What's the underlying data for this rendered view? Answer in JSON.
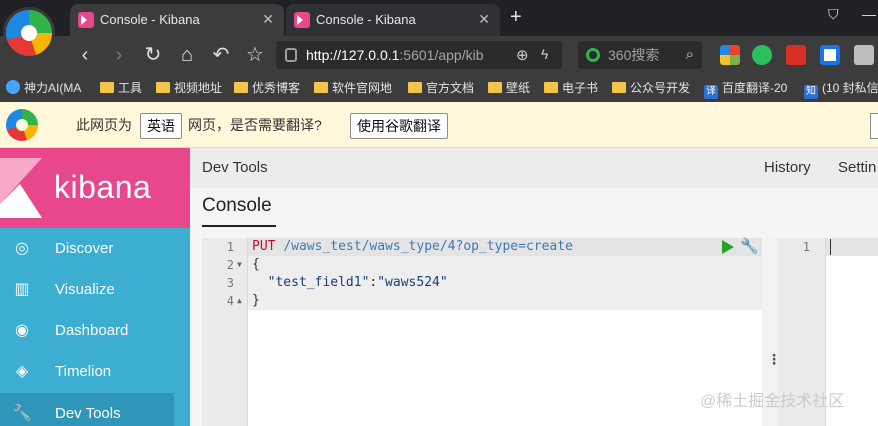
{
  "browser": {
    "tabs": [
      {
        "title": "Console - Kibana",
        "close": "✕"
      },
      {
        "title": "Console - Kibana",
        "close": "✕"
      }
    ],
    "new_tab": "+",
    "window_controls": {
      "shirt": "⛉",
      "minimize": "—"
    },
    "nav": {
      "back": "‹",
      "forward": "›",
      "reload": "↻",
      "home": "⌂",
      "undo": "↶",
      "star": "☆"
    },
    "address": {
      "host": "http://127.0.0.1",
      "rest": ":5601/app/kib",
      "zoom": "⊕",
      "bolt": "ϟ"
    },
    "search": {
      "placeholder": "360搜索",
      "icon": "⌕"
    },
    "extensions": [
      {
        "name": "windows-icon",
        "color": "#e8452c"
      },
      {
        "name": "evernote-icon",
        "color": "#2dbe60"
      },
      {
        "name": "fe-icon",
        "color": "#d93025"
      },
      {
        "name": "layers-icon",
        "color": "#1a73e8"
      },
      {
        "name": "bookmark-ext-icon",
        "color": "#9e9e9e"
      }
    ]
  },
  "bookmarks": [
    {
      "label": "神力AI(MA",
      "icon": "round"
    },
    {
      "label": "工具",
      "icon": "folder"
    },
    {
      "label": "视频地址",
      "icon": "folder"
    },
    {
      "label": "优秀博客",
      "icon": "folder"
    },
    {
      "label": "软件官网地",
      "icon": "folder"
    },
    {
      "label": "官方文档",
      "icon": "folder"
    },
    {
      "label": "壁纸",
      "icon": "folder"
    },
    {
      "label": "电子书",
      "icon": "folder"
    },
    {
      "label": "公众号开发",
      "icon": "folder"
    },
    {
      "label": "百度翻译-20",
      "icon": "badge",
      "badge": "译"
    },
    {
      "label": "(10 封私信",
      "icon": "badge",
      "badge": "知"
    }
  ],
  "translate_bar": {
    "prefix": "此网页为",
    "language": "英语",
    "middle": "网页，是否需要翻译?",
    "action": "使用谷歌翻译"
  },
  "kibana": {
    "brand": "kibana",
    "nav": [
      {
        "label": "Discover",
        "icon": "◎"
      },
      {
        "label": "Visualize",
        "icon": "▥"
      },
      {
        "label": "Dashboard",
        "icon": "◉"
      },
      {
        "label": "Timelion",
        "icon": "◈"
      },
      {
        "label": "Dev Tools",
        "icon": "🔧"
      }
    ]
  },
  "devtools": {
    "title": "Dev Tools",
    "history": "History",
    "settings": "Settin",
    "tab": "Console",
    "editor": {
      "line_numbers": [
        "1",
        "2",
        "3",
        "4"
      ],
      "method": "PUT",
      "path": "/waws_test/waws_type/4?op_type=create",
      "open_brace": "{",
      "key": "\"test_field1\"",
      "colon": ":",
      "value": "\"waws524\"",
      "close_brace": "}",
      "fold_down": "▼",
      "fold_up": "▲",
      "wrench": "🔧"
    },
    "resizer": "⋮",
    "output": {
      "line_numbers": [
        "1"
      ]
    }
  },
  "watermark": "@稀土掘金技术社区"
}
